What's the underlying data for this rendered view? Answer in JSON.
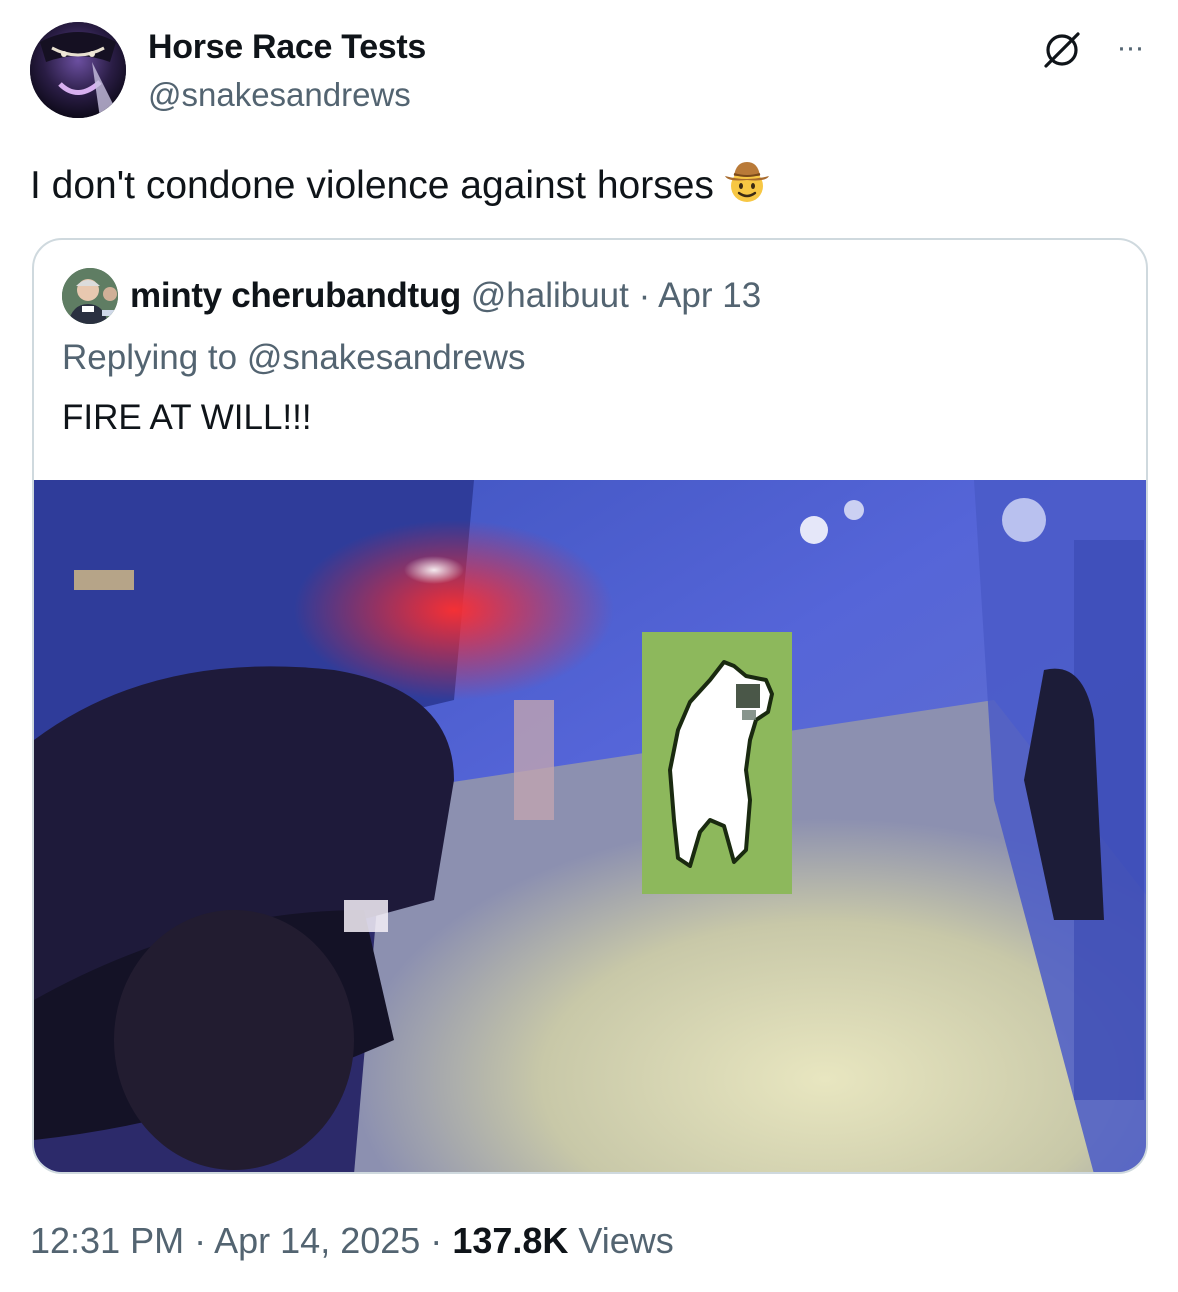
{
  "author": {
    "display_name": "Horse Race Tests",
    "handle": "@snakesandrews",
    "avatar_icon": "avatar-masked-figure"
  },
  "tweet": {
    "text": "I don't condone violence against horses",
    "emoji": "cowboy-hat-face-emoji"
  },
  "actions": {
    "grok_icon": "grok-icon",
    "more_label": "···"
  },
  "quote": {
    "display_name": "minty cherubandtug",
    "handle": "@halibuut",
    "separator": "·",
    "date": "Apr 13",
    "replying_to_label": "Replying to",
    "replying_to_handle": "@snakesandrews",
    "text": "FIRE AT WILL!!!",
    "media_icon": "security-camera-photo-with-pixel-horse"
  },
  "footer": {
    "time": "12:31 PM",
    "separator": "·",
    "date": "Apr 14, 2025",
    "views_count": "137.8K",
    "views_label": "Views"
  },
  "colors": {
    "text_primary": "#0f1419",
    "text_secondary": "#536471",
    "border": "#cfd9de"
  }
}
